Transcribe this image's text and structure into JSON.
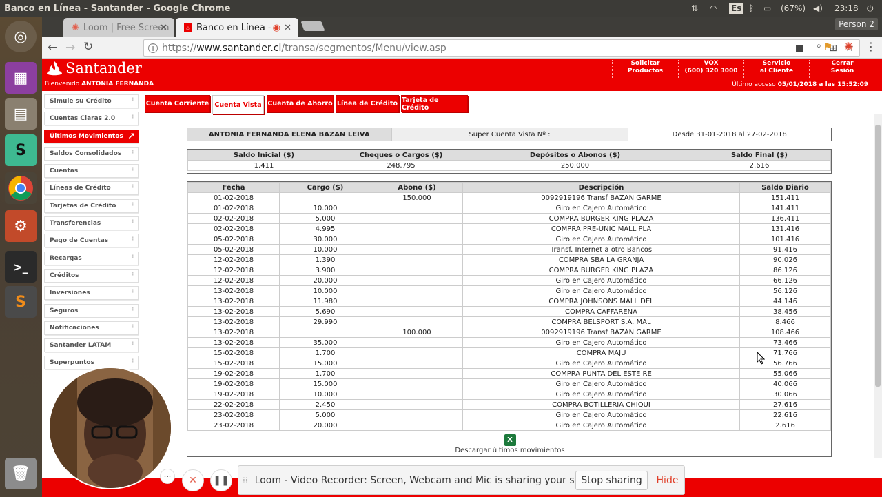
{
  "os": {
    "window_title": "Banco en Línea - Santander - Google Chrome",
    "keyboard_layout": "Es",
    "battery": "(67%)",
    "clock": "23:18"
  },
  "browser": {
    "tabs": [
      {
        "label": "Loom | Free Screen",
        "active": false
      },
      {
        "label": "Banco en Línea -",
        "active": true
      }
    ],
    "profile": "Person 2",
    "url_prefix": "https://",
    "url_host": "www.santander.cl",
    "url_path": "/transa/segmentos/Menu/view.asp"
  },
  "header": {
    "brand": "Santander",
    "welcome_prefix": "Bienvenido",
    "user_name": "ANTONIA FERNANDA",
    "links": [
      {
        "line1": "Solicitar Productos",
        "line2": ""
      },
      {
        "line1": "VOX",
        "line2": "(600) 320 3000"
      },
      {
        "line1": "Servicio",
        "line2": "al Cliente"
      },
      {
        "line1": "Cerrar",
        "line2": "Sesión"
      }
    ],
    "last_access_prefix": "Último acceso",
    "last_access_value": "05/01/2018 a las 15:52:09"
  },
  "sidebar": {
    "items": [
      {
        "label": "Simule su Crédito",
        "active": false
      },
      {
        "label": "Cuentas Claras 2.0",
        "active": false
      },
      {
        "label": "Últimos Movimientos",
        "active": true
      },
      {
        "label": "Saldos Consolidados",
        "active": false
      },
      {
        "label": "Cuentas",
        "active": false
      },
      {
        "label": "Líneas de Crédito",
        "active": false
      },
      {
        "label": "Tarjetas de Crédito",
        "active": false
      },
      {
        "label": "Transferencias",
        "active": false
      },
      {
        "label": "Pago de Cuentas",
        "active": false
      },
      {
        "label": "Recargas",
        "active": false
      },
      {
        "label": "Créditos",
        "active": false
      },
      {
        "label": "Inversiones",
        "active": false
      },
      {
        "label": "Seguros",
        "active": false
      },
      {
        "label": "Notificaciones",
        "active": false
      },
      {
        "label": "Santander LATAM",
        "active": false
      },
      {
        "label": "Superpuntos",
        "active": false
      }
    ]
  },
  "account_tabs": [
    {
      "label": "Cuenta Corriente",
      "selected": false
    },
    {
      "label": "Cuenta Vista",
      "selected": true
    },
    {
      "label": "Cuenta de Ahorro",
      "selected": false
    },
    {
      "label": "Línea de Crédito",
      "selected": false
    },
    {
      "label": "Tarjeta de Crédito",
      "selected": false
    }
  ],
  "account_info": {
    "holder": "ANTONIA FERNANDA ELENA BAZAN LEIVA",
    "product": "Super Cuenta Vista    Nº :",
    "period": "Desde 31-01-2018 al 27-02-2018"
  },
  "summary": {
    "headers": [
      "Saldo Inicial ($)",
      "Cheques o Cargos ($)",
      "Depósitos o Abonos ($)",
      "Saldo Final ($)"
    ],
    "values": [
      "1.411",
      "248.795",
      "250.000",
      "2.616"
    ]
  },
  "movements": {
    "headers": [
      "Fecha",
      "Cargo ($)",
      "Abono ($)",
      "Descripción",
      "Saldo Diario"
    ],
    "rows": [
      [
        "01-02-2018",
        "",
        "150.000",
        "0092919196 Transf BAZAN GARME",
        "151.411"
      ],
      [
        "01-02-2018",
        "10.000",
        "",
        "Giro en Cajero Automático",
        "141.411"
      ],
      [
        "02-02-2018",
        "5.000",
        "",
        "COMPRA BURGER KING PLAZA",
        "136.411"
      ],
      [
        "02-02-2018",
        "4.995",
        "",
        "COMPRA PRE-UNIC MALL PLA",
        "131.416"
      ],
      [
        "05-02-2018",
        "30.000",
        "",
        "Giro en Cajero Automático",
        "101.416"
      ],
      [
        "05-02-2018",
        "10.000",
        "",
        "Transf. Internet a otro Bancos",
        "91.416"
      ],
      [
        "12-02-2018",
        "1.390",
        "",
        "COMPRA SBA LA GRANJA",
        "90.026"
      ],
      [
        "12-02-2018",
        "3.900",
        "",
        "COMPRA BURGER KING PLAZA",
        "86.126"
      ],
      [
        "12-02-2018",
        "20.000",
        "",
        "Giro en Cajero Automático",
        "66.126"
      ],
      [
        "13-02-2018",
        "10.000",
        "",
        "Giro en Cajero Automático",
        "56.126"
      ],
      [
        "13-02-2018",
        "11.980",
        "",
        "COMPRA JOHNSONS MALL DEL",
        "44.146"
      ],
      [
        "13-02-2018",
        "5.690",
        "",
        "COMPRA CAFFARENA",
        "38.456"
      ],
      [
        "13-02-2018",
        "29.990",
        "",
        "COMPRA BELSPORT S.A. MAL",
        "8.466"
      ],
      [
        "13-02-2018",
        "",
        "100.000",
        "0092919196 Transf BAZAN GARME",
        "108.466"
      ],
      [
        "13-02-2018",
        "35.000",
        "",
        "Giro en Cajero Automático",
        "73.466"
      ],
      [
        "15-02-2018",
        "1.700",
        "",
        "COMPRA MAJU",
        "71.766"
      ],
      [
        "15-02-2018",
        "15.000",
        "",
        "Giro en Cajero Automático",
        "56.766"
      ],
      [
        "19-02-2018",
        "1.700",
        "",
        "COMPRA PUNTA DEL ESTE RE",
        "55.066"
      ],
      [
        "19-02-2018",
        "15.000",
        "",
        "Giro en Cajero Automático",
        "40.066"
      ],
      [
        "19-02-2018",
        "10.000",
        "",
        "Giro en Cajero Automático",
        "30.066"
      ],
      [
        "22-02-2018",
        "2.450",
        "",
        "COMPRA BOTILLERIA CHIQUI",
        "27.616"
      ],
      [
        "23-02-2018",
        "5.000",
        "",
        "Giro en Cajero Automático",
        "22.616"
      ],
      [
        "23-02-2018",
        "20.000",
        "",
        "Giro en Cajero Automático",
        "2.616"
      ]
    ],
    "download_label": "Descargar últimos movimientos"
  },
  "loom": {
    "message": "Loom - Video Recorder: Screen, Webcam and Mic is sharing your screen.",
    "stop_label": "Stop sharing",
    "hide_label": "Hide"
  },
  "colors": {
    "santander_red": "#ec0000",
    "ubuntu_panel": "#3c3b37"
  }
}
